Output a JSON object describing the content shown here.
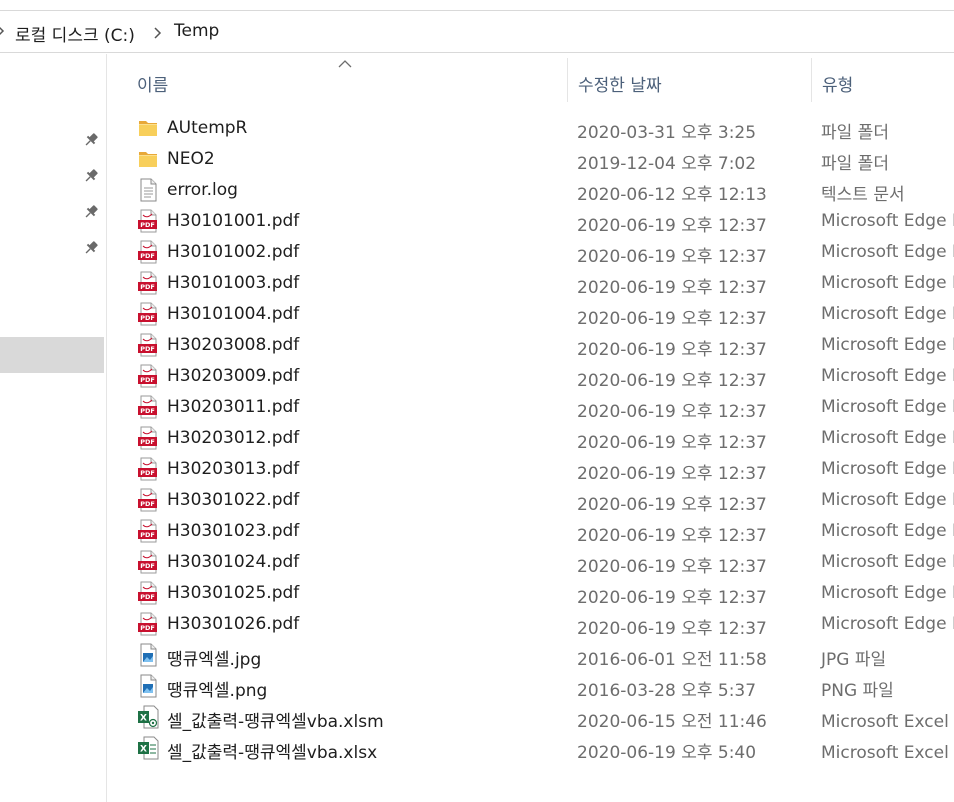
{
  "breadcrumb": {
    "items": [
      "로컬 디스크 (C:)",
      "Temp"
    ]
  },
  "columns": {
    "name": "이름",
    "date": "수정한 날짜",
    "type": "유형"
  },
  "files": [
    {
      "name": "AUtempR",
      "date": "2020-03-31 오후 3:25",
      "type": "파일 폴더",
      "icon": "folder-icon"
    },
    {
      "name": "NEO2",
      "date": "2019-12-04 오후 7:02",
      "type": "파일 폴더",
      "icon": "folder-icon"
    },
    {
      "name": "error.log",
      "date": "2020-06-12 오후 12:13",
      "type": "텍스트 문서",
      "icon": "text-file-icon"
    },
    {
      "name": "H30101001.pdf",
      "date": "2020-06-19 오후 12:37",
      "type": "Microsoft Edge P",
      "icon": "pdf-icon"
    },
    {
      "name": "H30101002.pdf",
      "date": "2020-06-19 오후 12:37",
      "type": "Microsoft Edge P",
      "icon": "pdf-icon"
    },
    {
      "name": "H30101003.pdf",
      "date": "2020-06-19 오후 12:37",
      "type": "Microsoft Edge P",
      "icon": "pdf-icon"
    },
    {
      "name": "H30101004.pdf",
      "date": "2020-06-19 오후 12:37",
      "type": "Microsoft Edge P",
      "icon": "pdf-icon"
    },
    {
      "name": "H30203008.pdf",
      "date": "2020-06-19 오후 12:37",
      "type": "Microsoft Edge P",
      "icon": "pdf-icon"
    },
    {
      "name": "H30203009.pdf",
      "date": "2020-06-19 오후 12:37",
      "type": "Microsoft Edge P",
      "icon": "pdf-icon"
    },
    {
      "name": "H30203011.pdf",
      "date": "2020-06-19 오후 12:37",
      "type": "Microsoft Edge P",
      "icon": "pdf-icon"
    },
    {
      "name": "H30203012.pdf",
      "date": "2020-06-19 오후 12:37",
      "type": "Microsoft Edge P",
      "icon": "pdf-icon"
    },
    {
      "name": "H30203013.pdf",
      "date": "2020-06-19 오후 12:37",
      "type": "Microsoft Edge P",
      "icon": "pdf-icon"
    },
    {
      "name": "H30301022.pdf",
      "date": "2020-06-19 오후 12:37",
      "type": "Microsoft Edge P",
      "icon": "pdf-icon"
    },
    {
      "name": "H30301023.pdf",
      "date": "2020-06-19 오후 12:37",
      "type": "Microsoft Edge P",
      "icon": "pdf-icon"
    },
    {
      "name": "H30301024.pdf",
      "date": "2020-06-19 오후 12:37",
      "type": "Microsoft Edge P",
      "icon": "pdf-icon"
    },
    {
      "name": "H30301025.pdf",
      "date": "2020-06-19 오후 12:37",
      "type": "Microsoft Edge P",
      "icon": "pdf-icon"
    },
    {
      "name": "H30301026.pdf",
      "date": "2020-06-19 오후 12:37",
      "type": "Microsoft Edge P",
      "icon": "pdf-icon"
    },
    {
      "name": "땡큐엑셀.jpg",
      "date": "2016-06-01 오전 11:58",
      "type": "JPG 파일",
      "icon": "image-file-icon"
    },
    {
      "name": "땡큐엑셀.png",
      "date": "2016-03-28 오후 5:37",
      "type": "PNG 파일",
      "icon": "image-file-icon"
    },
    {
      "name": "셀_값출력-땡큐엑셀vba.xlsm",
      "date": "2020-06-15 오전 11:46",
      "type": "Microsoft Excel 매",
      "icon": "excel-macro-file-icon"
    },
    {
      "name": "셀_값출력-땡큐엑셀vba.xlsx",
      "date": "2020-06-19 오후 5:40",
      "type": "Microsoft Excel 워",
      "icon": "excel-file-icon"
    }
  ],
  "colors": {
    "header_text": "#4c607a",
    "secondary_text": "#6d6d6d",
    "folder": "#f5c33c",
    "pdf": "#c8102e",
    "excel": "#1e7145",
    "selection": "#d9d9d9"
  }
}
